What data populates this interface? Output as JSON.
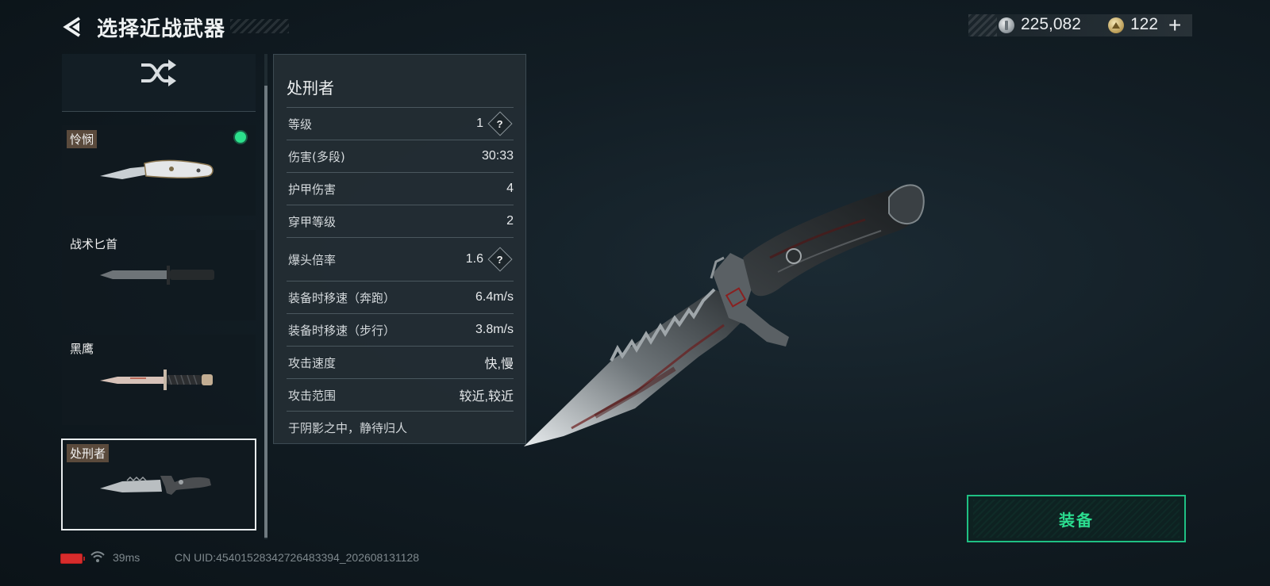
{
  "header": {
    "title": "选择近战武器"
  },
  "currency": {
    "silver": "225,082",
    "gold": "122",
    "plus_label": "+"
  },
  "weapons": [
    {
      "name": "怜悯",
      "equipped": true,
      "selected": false
    },
    {
      "name": "战术匕首",
      "equipped": false,
      "selected": false
    },
    {
      "name": "黑鹰",
      "equipped": false,
      "selected": false
    },
    {
      "name": "处刑者",
      "equipped": false,
      "selected": true
    }
  ],
  "detail": {
    "name": "处刑者",
    "stats": [
      {
        "label": "等级",
        "value": "1",
        "help": true
      },
      {
        "label": "伤害(多段)",
        "value": "30:33",
        "help": false
      },
      {
        "label": "护甲伤害",
        "value": "4",
        "help": false
      },
      {
        "label": "穿甲等级",
        "value": "2",
        "help": false
      },
      {
        "label": "爆头倍率",
        "value": "1.6",
        "help": true
      },
      {
        "label": "装备时移速（奔跑）",
        "value": "6.4m/s",
        "help": false
      },
      {
        "label": "装备时移速（步行）",
        "value": "3.8m/s",
        "help": false
      },
      {
        "label": "攻击速度",
        "value": "快,慢",
        "help": false
      },
      {
        "label": "攻击范围",
        "value": "较近,较近",
        "help": false
      }
    ],
    "flavor": "于阴影之中，静待归人",
    "help_glyph": "?"
  },
  "equip_button": {
    "label": "装备"
  },
  "status": {
    "ping": "39ms",
    "uid": "CN UID:4540152834272​6483394_202608131128"
  },
  "colors": {
    "accent": "#2bdc8f",
    "equipped": "#2ce08c",
    "battery": "#d72c2c",
    "tag": "#5a4a3c"
  },
  "icons": {
    "back": "chevron-left-icon",
    "shuffle": "shuffle-icon",
    "silver": "silver-coin-icon",
    "gold": "gold-coin-icon",
    "help": "help-icon",
    "battery": "battery-icon",
    "wifi": "wifi-icon"
  }
}
